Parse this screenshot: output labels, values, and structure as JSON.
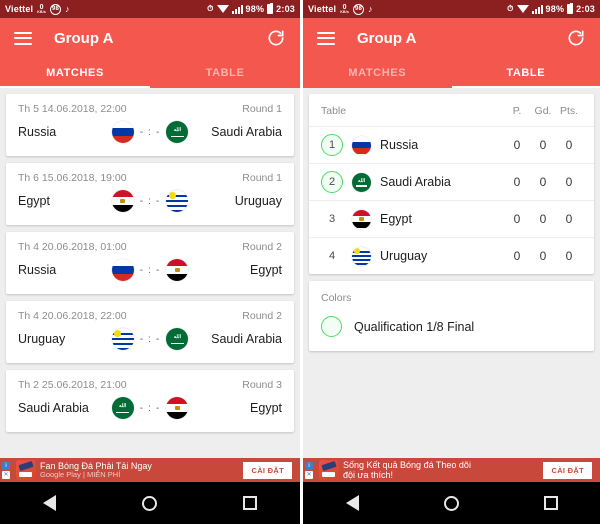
{
  "status_bar": {
    "carrier": "Viettel",
    "data_speed_value": "0",
    "data_speed_unit": "KB/s",
    "notification_badge": "98",
    "battery_percent": "98%",
    "clock": "2:03"
  },
  "app": {
    "title": "Group A",
    "menu_icon": "hamburger-icon",
    "refresh_icon": "refresh-icon",
    "tabs": [
      {
        "label": "MATCHES",
        "active_left": true
      },
      {
        "label": "TABLE",
        "active_left": false
      }
    ]
  },
  "matches_screen": {
    "active_tab_index": 0,
    "matches": [
      {
        "date": "Th 5 14.06.2018, 22:00",
        "round": "Round 1",
        "home": "Russia",
        "away": "Saudi Arabia",
        "home_flag": "russia",
        "away_flag": "saudi",
        "score": "- : -"
      },
      {
        "date": "Th 6 15.06.2018, 19:00",
        "round": "Round 1",
        "home": "Egypt",
        "away": "Uruguay",
        "home_flag": "egypt",
        "away_flag": "uruguay",
        "score": "- : -"
      },
      {
        "date": "Th 4 20.06.2018, 01:00",
        "round": "Round 2",
        "home": "Russia",
        "away": "Egypt",
        "home_flag": "russia",
        "away_flag": "egypt",
        "score": "- : -"
      },
      {
        "date": "Th 4 20.06.2018, 22:00",
        "round": "Round 2",
        "home": "Uruguay",
        "away": "Saudi Arabia",
        "home_flag": "uruguay",
        "away_flag": "saudi",
        "score": "- : -"
      },
      {
        "date": "Th 2 25.06.2018, 21:00",
        "round": "Round 3",
        "home": "Saudi Arabia",
        "away": "Egypt",
        "home_flag": "saudi",
        "away_flag": "egypt",
        "score": "- : -"
      }
    ]
  },
  "table_screen": {
    "active_tab_index": 1,
    "table_label": "Table",
    "columns": [
      "P.",
      "Gd.",
      "Pts."
    ],
    "rows": [
      {
        "pos": "1",
        "team": "Russia",
        "flag": "russia",
        "p": "0",
        "gd": "0",
        "pts": "0",
        "qualified": true
      },
      {
        "pos": "2",
        "team": "Saudi Arabia",
        "flag": "saudi",
        "p": "0",
        "gd": "0",
        "pts": "0",
        "qualified": true
      },
      {
        "pos": "3",
        "team": "Egypt",
        "flag": "egypt",
        "p": "0",
        "gd": "0",
        "pts": "0",
        "qualified": false
      },
      {
        "pos": "4",
        "team": "Uruguay",
        "flag": "uruguay",
        "p": "0",
        "gd": "0",
        "pts": "0",
        "qualified": false
      }
    ],
    "colors_label": "Colors",
    "legend": [
      {
        "swatch_color": "#4cd964",
        "label": "Qualification 1/8 Final"
      }
    ]
  },
  "ads": {
    "left": {
      "line1": "Fan Bóng Đá Phải Tải Ngay",
      "line2": "Google Play  |  MIỄN PHÍ",
      "button": "CÀI ĐẶT"
    },
    "right": {
      "line1": "Sống Kết quả Bóng đá Theo dõi",
      "line2": "đội ưa thích!",
      "button": "CÀI ĐẶT"
    }
  },
  "nav_bar": {
    "back": "back-icon",
    "home": "home-icon",
    "recents": "recents-icon"
  },
  "colors": {
    "accent": "#f4574e",
    "status_bar": "#8c2020",
    "qualify_green": "#4cd964",
    "background": "#eeeeee"
  }
}
